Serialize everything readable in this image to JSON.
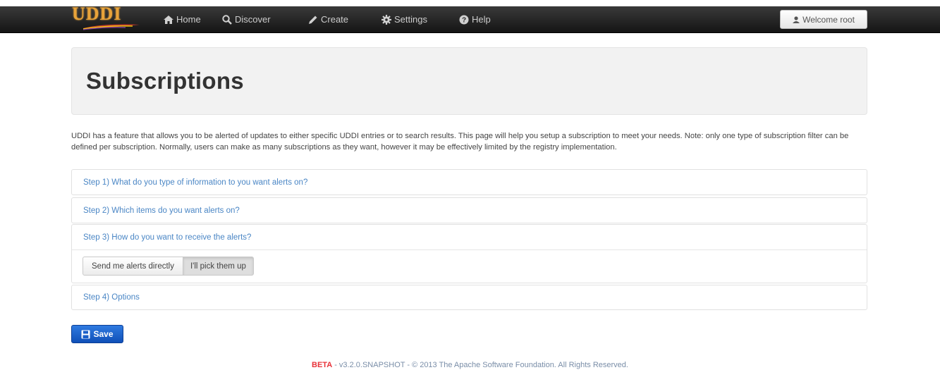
{
  "navbar": {
    "logo_text": "UDDI",
    "items": [
      {
        "label": "Home",
        "icon": "home-icon"
      },
      {
        "label": "Discover",
        "icon": "search-icon"
      },
      {
        "label": "Create",
        "icon": "pencil-icon"
      },
      {
        "label": "Settings",
        "icon": "gear-icon"
      },
      {
        "label": "Help",
        "icon": "question-circle-icon"
      }
    ],
    "welcome_label": "Welcome root"
  },
  "page": {
    "title": "Subscriptions",
    "description": "UDDI has a feature that allows you to be alerted of updates to either specific UDDI entries or to search results. This page will help you setup a subscription to meet your needs. Note: only one type of subscription filter can be defined per subscription. Normally, users can make as many subscriptions as they want, however it may be effectively limited by the registry implementation."
  },
  "steps": [
    {
      "label": "Step 1) What do you type of information to you want alerts on?"
    },
    {
      "label": "Step 2) Which items do you want alerts on?"
    },
    {
      "label": "Step 3) How do you want to receive the alerts?"
    },
    {
      "label": "Step 4) Options"
    }
  ],
  "delivery": {
    "options": [
      "Send me alerts directly",
      "I'll pick them up"
    ],
    "selected": "I'll pick them up"
  },
  "save_label": "Save",
  "footer": {
    "beta": "BETA",
    "version_text": " - v3.2.0.SNAPSHOT - © 2013 The Apache Software Foundation. All Rights Reserved."
  },
  "colors": {
    "navbar": "#222222",
    "link": "#4a86c5",
    "primary": "#1a5fc8",
    "beta": "#e8333a"
  }
}
